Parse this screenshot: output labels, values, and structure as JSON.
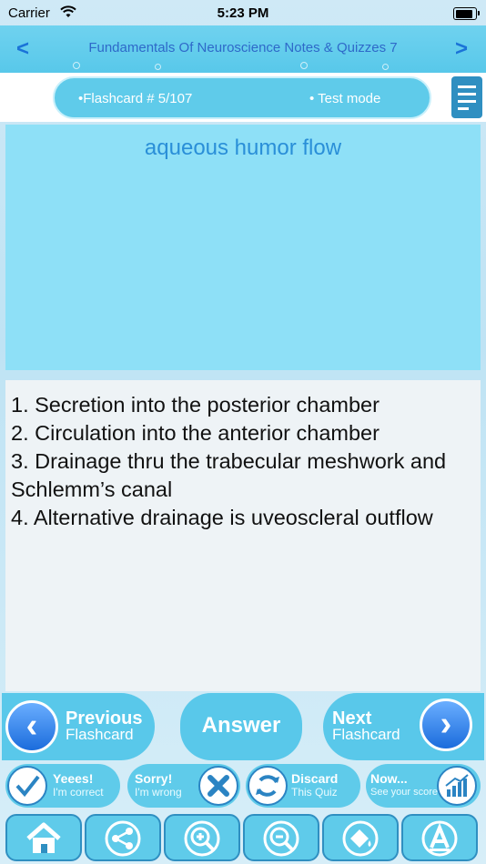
{
  "status_bar": {
    "carrier": "Carrier",
    "time": "5:23 PM"
  },
  "header": {
    "prev_arrow": "<",
    "next_arrow": ">",
    "title": "Fundamentals Of Neuroscience Notes & Quizzes 7"
  },
  "mode_bar": {
    "flashcard": "•Flashcard #  5/107",
    "test_mode": "• Test mode"
  },
  "card": {
    "question": "aqueous humor flow",
    "answer_lines": [
      "1. Secretion into the posterior chamber",
      "2. Circulation into the anterior chamber",
      "3. Drainage thru the trabecular meshwork and",
      "Schlemm’s canal",
      "4. Alternative drainage is uveoscleral outflow"
    ]
  },
  "nav": {
    "previous_title": "Previous",
    "previous_sub": "Flashcard",
    "answer": "Answer",
    "next_title": "Next",
    "next_sub": "Flashcard"
  },
  "actions": {
    "correct_title": "Yeees!",
    "correct_sub": "I'm correct",
    "wrong_title": "Sorry!",
    "wrong_sub": "I'm wrong",
    "discard_title": "Discard",
    "discard_sub": "This Quiz",
    "score_title": "Now...",
    "score_sub": "See your score"
  },
  "toolbar_icons": [
    "home-icon",
    "share-icon",
    "zoom-in-icon",
    "zoom-out-icon",
    "paint-bucket-icon",
    "font-icon"
  ],
  "colors": {
    "accent": "#59c8ea",
    "title_text": "#2e69c9",
    "question_text": "#2a8fd8",
    "circle_button": "#1b6cdc"
  }
}
